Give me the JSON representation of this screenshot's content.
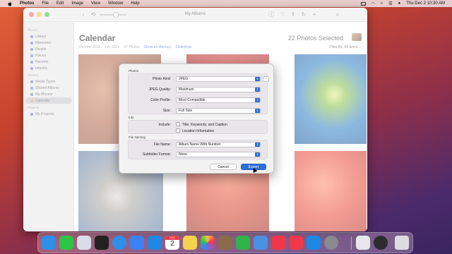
{
  "menubar": {
    "items": [
      {
        "label": "Photos",
        "bold": true
      },
      {
        "label": "File"
      },
      {
        "label": "Edit"
      },
      {
        "label": "Image"
      },
      {
        "label": "View"
      },
      {
        "label": "Window"
      },
      {
        "label": "Help"
      }
    ],
    "clock": "Thu Dec 2  10:30 AM"
  },
  "window": {
    "title": "My Albums"
  },
  "sidebar": {
    "sections": [
      {
        "label": "Photos",
        "items": [
          "Library",
          "Memories",
          "People",
          "Places",
          "Recents",
          "Imports"
        ]
      },
      {
        "label": "Albums",
        "items": [
          "Media Types",
          "Shared Albums",
          "My Albums",
          "Calendar"
        ]
      },
      {
        "label": "Projects",
        "items": [
          "My Projects"
        ]
      }
    ],
    "active": "Calendar"
  },
  "content": {
    "title": "Calendar",
    "date_range": "October 2016 – July 2021",
    "photo_count": "22 Photos",
    "show_memory": "Show as Memory",
    "slideshow": "Slideshow",
    "selected": "22 Photos Selected",
    "filter": "Filter By: All Items ⌄"
  },
  "export_sheet": {
    "section_photos": "Photos",
    "photo_kind_label": "Photo Kind:",
    "photo_kind_value": "JPEG",
    "quality_label": "JPEG Quality:",
    "quality_value": "Maximum",
    "profile_label": "Color Profile:",
    "profile_value": "Most Compatible",
    "size_label": "Size:",
    "size_value": "Full Size",
    "section_info": "Info",
    "include_label": "Include:",
    "include_opt1": "Title, Keywords, and Caption",
    "include_opt2": "Location Information",
    "section_naming": "File Naming",
    "filename_label": "File Name:",
    "filename_value": "Album Name With Number",
    "subfolder_label": "Subfolder Format:",
    "subfolder_value": "None",
    "cancel": "Cancel",
    "export": "Export"
  },
  "dock": {
    "calendar_day": "2",
    "calendar_month": "DEC",
    "colors": {
      "finder": "#2f8ee8",
      "facetime": "#2ec448",
      "launchpad": "#d8dde8",
      "mission": "#222222",
      "safari": "#2f8ee8",
      "mail": "#3b82f6",
      "notes": "#f6d24c",
      "photos": "#ffffff",
      "keynote": "#4a90e2",
      "numbers": "#31b34b",
      "music": "#f2364a",
      "news": "#f2364a",
      "appstore": "#1e88e5",
      "settings": "#8a8a8e",
      "preview": "#e7e7ea",
      "quicktime": "#2c2c2e",
      "trash": "#dcdce0"
    }
  }
}
